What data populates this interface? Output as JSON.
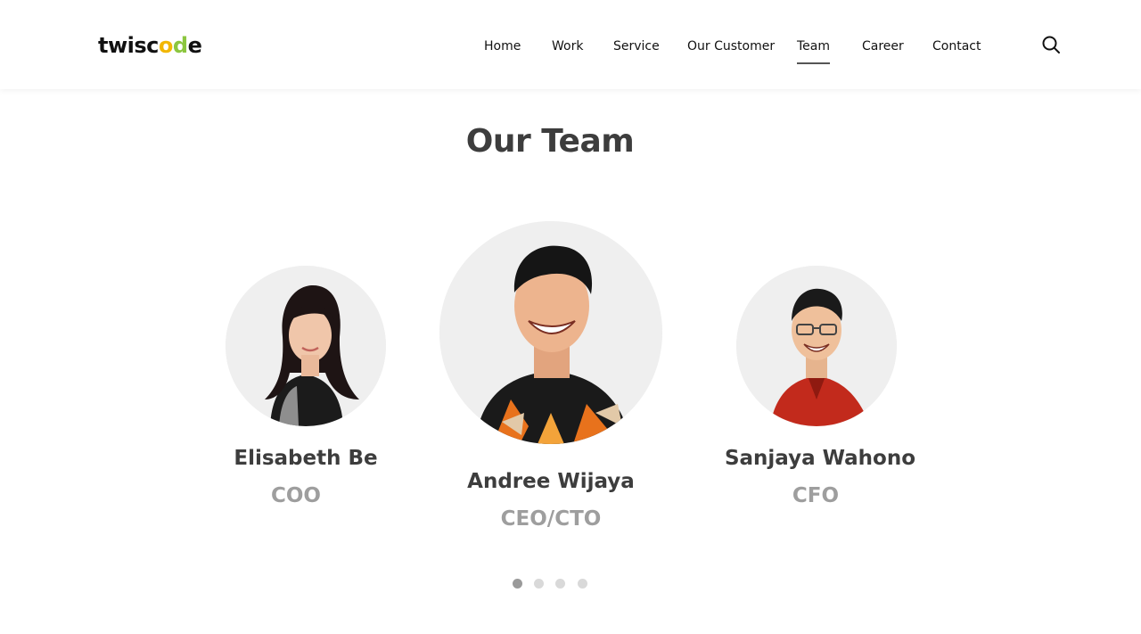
{
  "brand": {
    "logo_parts": [
      "twisc",
      "o",
      "d",
      "e"
    ],
    "logo_colors": [
      "#111111",
      "#f2b705",
      "#8cc63f",
      "#111111"
    ]
  },
  "nav": {
    "items": [
      {
        "label": "Home"
      },
      {
        "label": "Work"
      },
      {
        "label": "Service"
      },
      {
        "label": "Our Customer"
      },
      {
        "label": "Team",
        "active": true
      },
      {
        "label": "Career"
      },
      {
        "label": "Contact"
      }
    ],
    "search_icon": "search-icon"
  },
  "section": {
    "title": "Our Team"
  },
  "team": [
    {
      "name": "Elisabeth Be",
      "role": "COO"
    },
    {
      "name": "Andree Wijaya",
      "role": "CEO/CTO",
      "featured": true
    },
    {
      "name": "Sanjaya Wahono",
      "role": "CFO"
    }
  ],
  "carousel": {
    "pages": 4,
    "active_page": 1
  },
  "colors": {
    "heading": "#3d3d3d",
    "role_text": "#9e9e9e",
    "avatar_bg": "#efefef",
    "dot_active": "#9a9a9a",
    "dot_inactive": "#d9d9d9"
  }
}
